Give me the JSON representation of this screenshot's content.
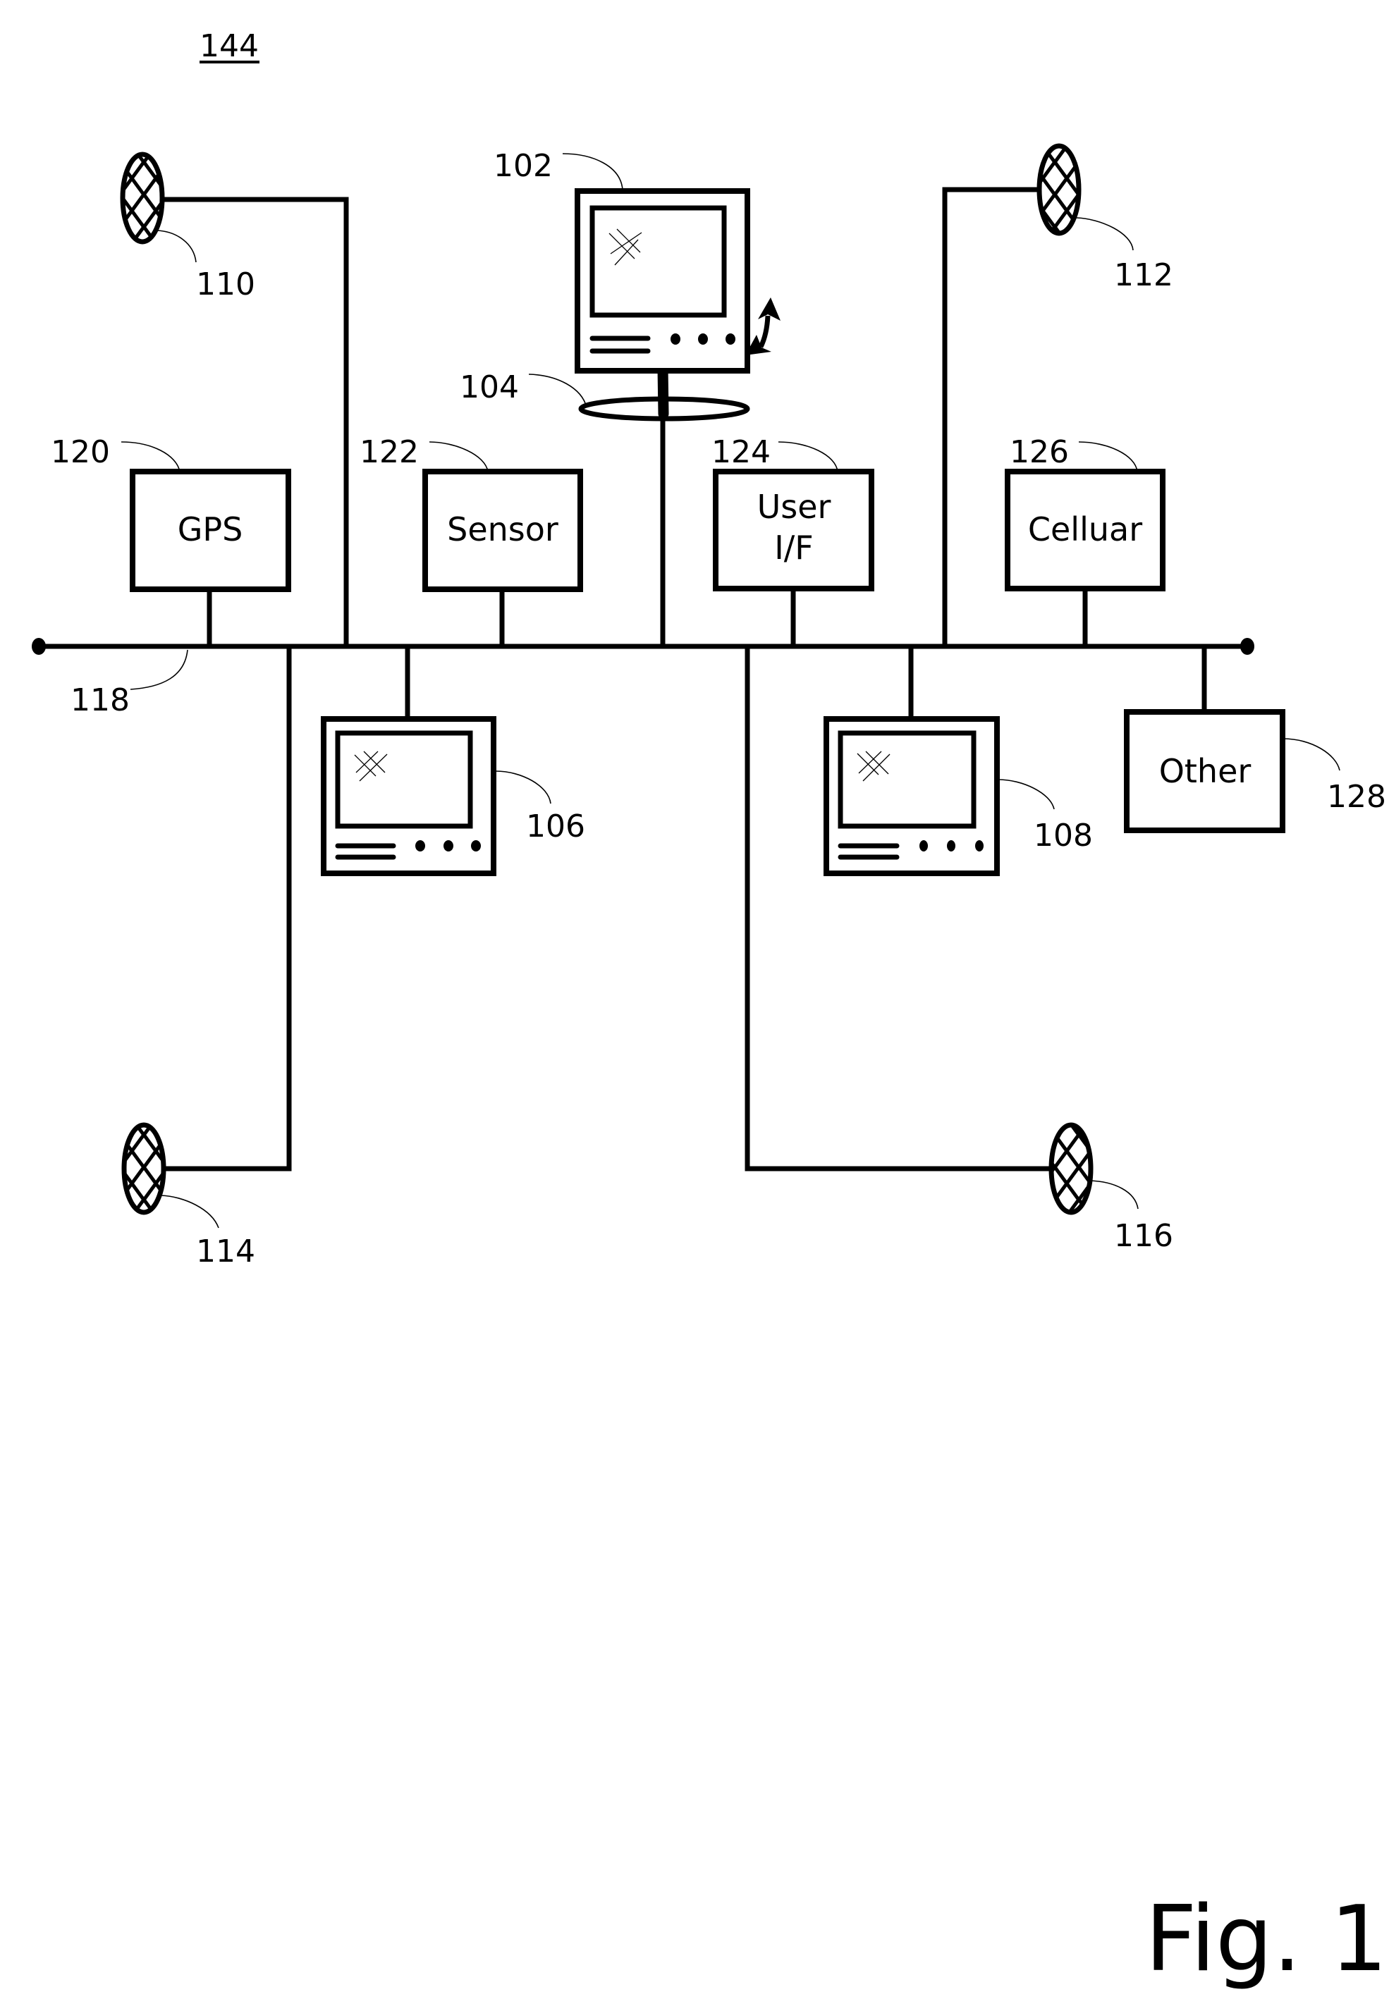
{
  "figure": {
    "reference": "144",
    "caption": "Fig. 1"
  },
  "bus": {
    "ref": "118"
  },
  "components": {
    "gps": {
      "ref": "120",
      "label": "GPS"
    },
    "sensor": {
      "ref": "122",
      "label": "Sensor"
    },
    "user_if": {
      "ref": "124",
      "label_line1": "User",
      "label_line2": "I/F"
    },
    "cellular": {
      "ref": "126",
      "label": "Celluar"
    },
    "other": {
      "ref": "128",
      "label": "Other"
    }
  },
  "displays": {
    "main": {
      "ref": "102",
      "mount_ref": "104"
    },
    "left": {
      "ref": "106"
    },
    "right": {
      "ref": "108"
    }
  },
  "speakers": {
    "front_left": {
      "ref": "110"
    },
    "front_right": {
      "ref": "112"
    },
    "rear_left": {
      "ref": "114"
    },
    "rear_right": {
      "ref": "116"
    }
  }
}
